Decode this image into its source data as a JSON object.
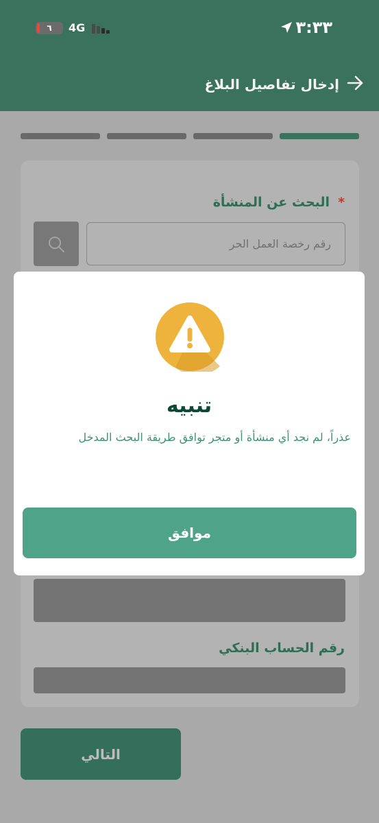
{
  "status_bar": {
    "time": "٣:٣٣",
    "network": "4G",
    "battery": "٦",
    "location_icon": "location-arrow-icon",
    "signal_icon": "cellular-signal-icon"
  },
  "header": {
    "title": "إدخال تفاصيل البلاغ",
    "back_icon": "arrow-right-icon"
  },
  "stepper": {
    "steps": 4,
    "current_step": 1
  },
  "form": {
    "search_label": "البحث عن المنشأة",
    "required_mark": "*",
    "search_placeholder": "رقم رخصة العمل الحر",
    "search_icon": "search-icon",
    "bank_account_label": "رقم الحساب البنكي"
  },
  "footer": {
    "next_label": "التالي"
  },
  "modal": {
    "icon": "warning-icon",
    "title": "تنبيه",
    "message": "عذراً، لم نجد أي منشأة أو متجر توافق طريقة البحث المدخل",
    "ok_label": "موافق"
  },
  "colors": {
    "brand_green": "#3a725d",
    "button_green": "#4fa388",
    "warning_yellow": "#eeb33c",
    "overlay_gray": "#a9a9a9"
  }
}
